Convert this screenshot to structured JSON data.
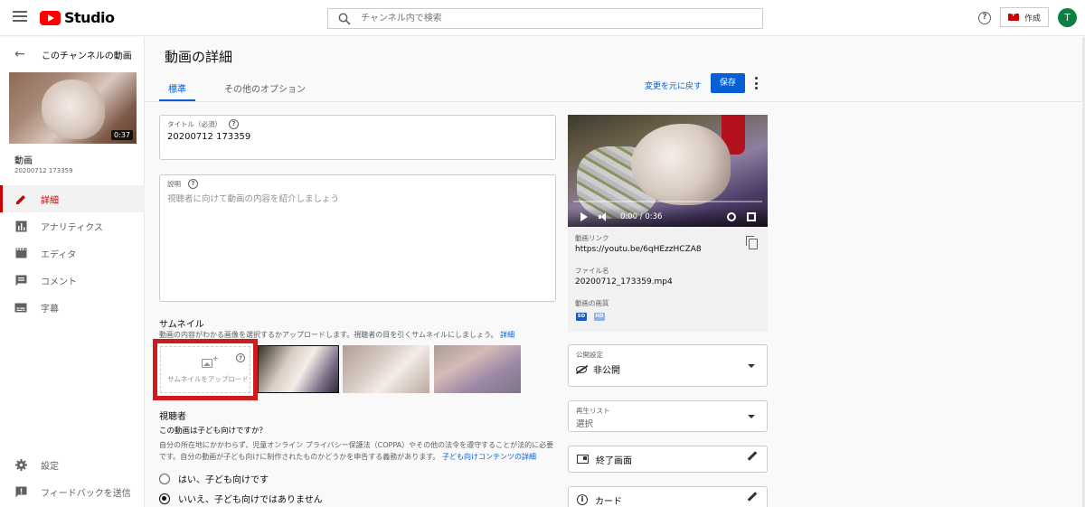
{
  "header": {
    "logo_text": "Studio",
    "search_placeholder": "チャンネル内で検索",
    "create_label": "作成",
    "avatar_letter": "T",
    "brand_color": "#ff0000"
  },
  "sidebar": {
    "back_label": "このチャンネルの動画",
    "video_duration": "0:37",
    "video_title": "動画",
    "video_subtitle": "20200712 173359",
    "nav": [
      {
        "label": "詳細",
        "icon": "pencil-icon",
        "active": true
      },
      {
        "label": "アナリティクス",
        "icon": "analytics-icon"
      },
      {
        "label": "エディタ",
        "icon": "clapperboard-icon"
      },
      {
        "label": "コメント",
        "icon": "comment-icon"
      },
      {
        "label": "字幕",
        "icon": "subtitles-icon"
      }
    ],
    "bottom": [
      {
        "label": "設定",
        "icon": "gear-icon"
      },
      {
        "label": "フィードバックを送信",
        "icon": "feedback-icon"
      }
    ]
  },
  "main": {
    "page_title": "動画の詳細",
    "tabs": [
      {
        "label": "標準",
        "active": true
      },
      {
        "label": "その他のオプション"
      }
    ],
    "undo_label": "変更を元に戻す",
    "save_label": "保存",
    "accent_color": "#065fd4",
    "title_field": {
      "label": "タイトル（必須）",
      "value": "20200712 173359"
    },
    "description_field": {
      "label": "説明",
      "placeholder": "視聴者に向けて動画の内容を紹介しましょう"
    },
    "thumbnail": {
      "title": "サムネイル",
      "description": "動画の内容がわかる画像を選択するかアップロードします。視聴者の目を引くサムネイルにしましょう。",
      "link": "詳細",
      "upload_label": "サムネイルをアップロード"
    },
    "audience": {
      "title": "視聴者",
      "question": "この動画は子ども向けですか？",
      "description": "自分の所在地にかかわらず、児童オンライン プライバシー保護法（COPPA）やその他の法令を遵守することが法的に必要です。自分の動画が子ども向けに制作されたものかどうかを申告する義務があります。",
      "link": "子ども向けコンテンツの詳細",
      "options": [
        {
          "label": "はい、子ども向けです",
          "checked": false
        },
        {
          "label": "いいえ、子ども向けではありません",
          "checked": true
        }
      ]
    }
  },
  "right_panel": {
    "player_time": "0:00 / 0:36",
    "link_label": "動画リンク",
    "link_value": "https://youtu.be/6qHEzzHCZA8",
    "filename_label": "ファイル名",
    "filename_value": "20200712_173359.mp4",
    "quality_label": "動画の画質",
    "quality_badges": [
      "SD",
      "HD"
    ],
    "visibility": {
      "label": "公開設定",
      "value": "非公開"
    },
    "playlist": {
      "label": "再生リスト",
      "value": "選択"
    },
    "end_screen_label": "終了画面",
    "cards_label": "カード"
  }
}
